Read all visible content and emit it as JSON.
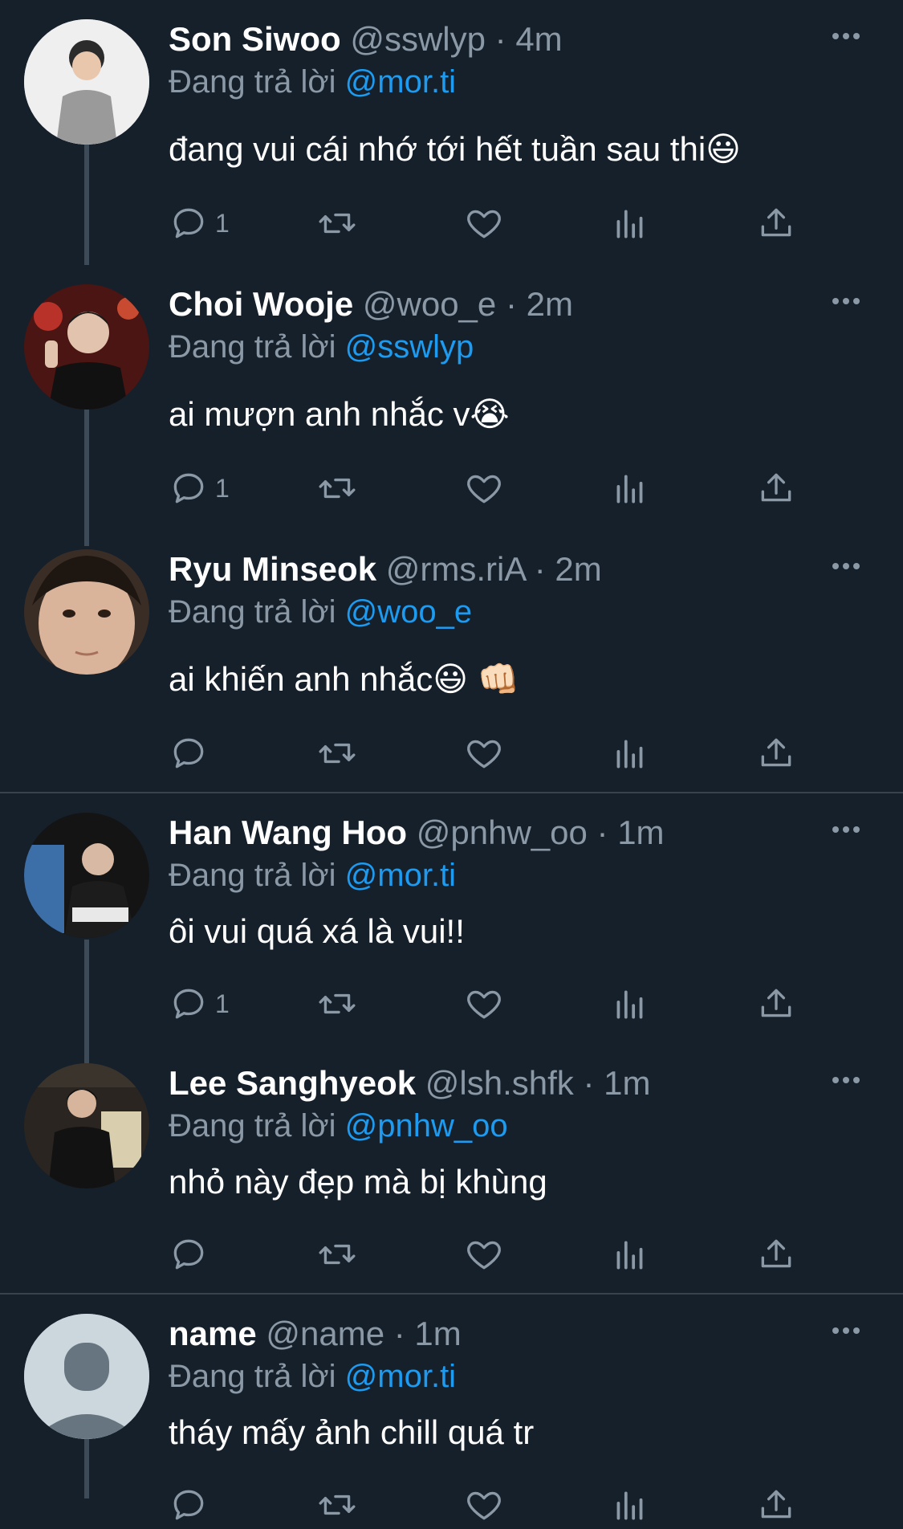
{
  "reply_prefix": "Đang trả lời",
  "tweets": [
    {
      "name": "Son Siwoo",
      "handle": "@sswlyp",
      "time": "4m",
      "reply_to": "@mor.ti",
      "text": "đang vui cái nhớ tới hết tuần sau thi",
      "emoji": "😃",
      "reply_count": "1"
    },
    {
      "name": "Choi Wooje",
      "handle": "@woo_e",
      "time": "2m",
      "reply_to": "@sswlyp",
      "text": "ai mượn anh nhắc v",
      "emoji": "😭",
      "reply_count": "1"
    },
    {
      "name": "Ryu Minseok",
      "handle": "@rms.riA",
      "time": "2m",
      "reply_to": "@woo_e",
      "text": "ai khiến anh nhắc",
      "emoji": "😃 👊🏻",
      "reply_count": ""
    },
    {
      "name": "Han Wang Hoo",
      "handle": "@pnhw_oo",
      "time": "1m",
      "reply_to": "@mor.ti",
      "text": "ôi vui quá xá là vui!!",
      "emoji": "",
      "reply_count": "1"
    },
    {
      "name": "Lee Sanghyeok",
      "handle": "@lsh.shfk",
      "time": "1m",
      "reply_to": "@pnhw_oo",
      "text": "nhỏ này đẹp mà bị khùng",
      "emoji": "",
      "reply_count": ""
    },
    {
      "name": "name",
      "handle": "@name",
      "time": "1m",
      "reply_to": "@mor.ti",
      "text": "tháy mấy ảnh chill quá tr",
      "emoji": "",
      "reply_count": ""
    }
  ],
  "icons": {
    "reply": "reply-icon",
    "retweet": "retweet-icon",
    "like": "heart-icon",
    "views": "views-icon",
    "share": "share-icon",
    "more": "more-icon"
  },
  "colors": {
    "background": "#15202b",
    "mention": "#1d9bf0",
    "muted": "#8b98a5",
    "divider": "#38444d"
  }
}
